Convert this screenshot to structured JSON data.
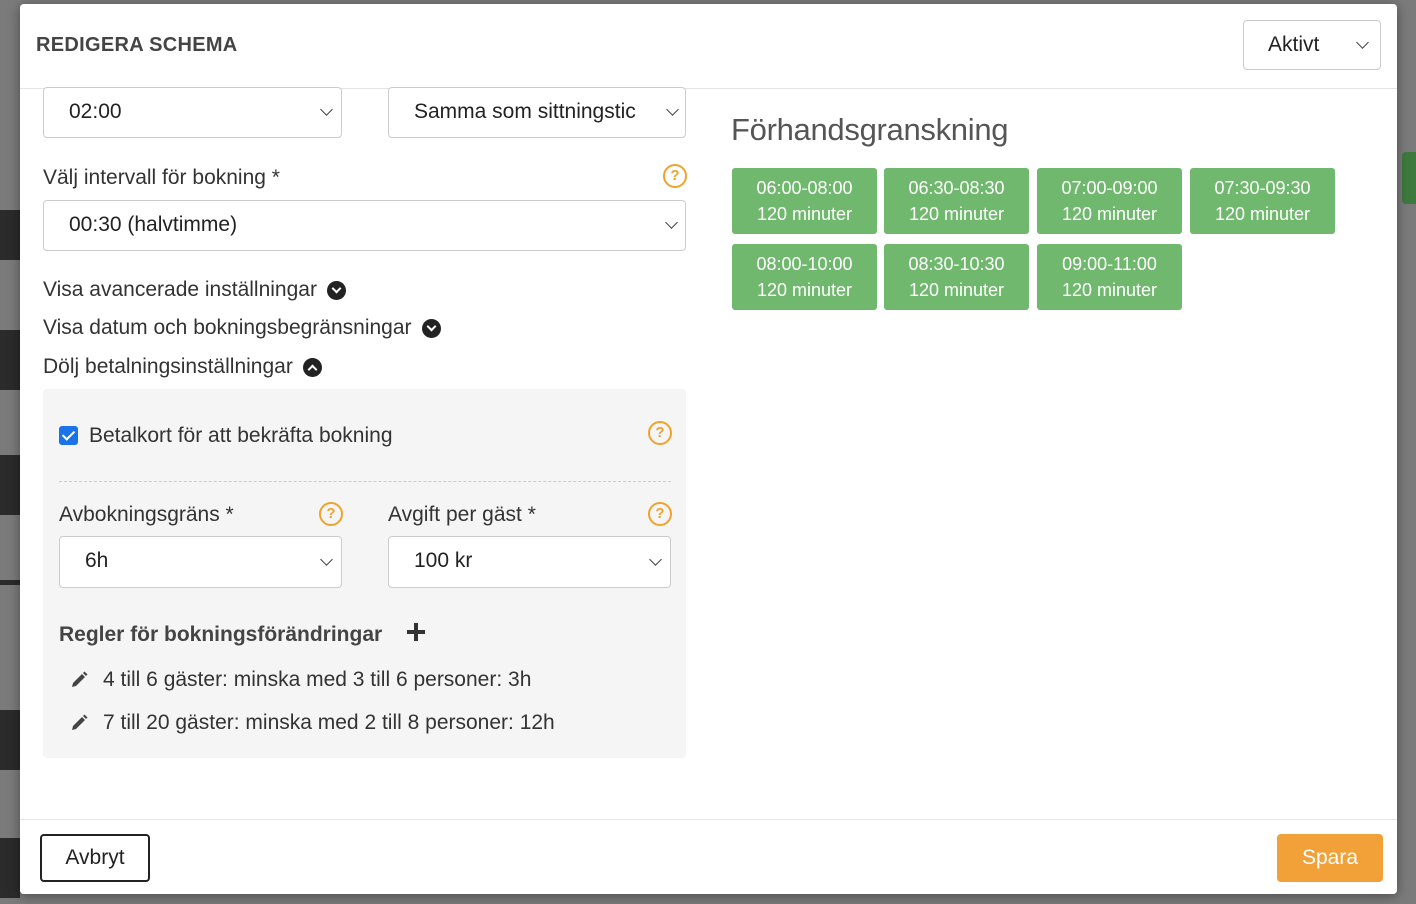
{
  "modal": {
    "title": "REDIGERA SCHEMA",
    "status": {
      "value": "Aktivt"
    }
  },
  "form": {
    "duration_select": {
      "value": "02:00"
    },
    "other_select": {
      "value": "Samma som sittningstic"
    },
    "interval": {
      "label": "Välj intervall för bokning *",
      "value": "00:30 (halvtimme)"
    },
    "toggles": {
      "advanced": "Visa avancerade inställningar",
      "dates": "Visa datum och bokningsbegränsningar",
      "payment": "Dölj betalningsinställningar"
    },
    "payment": {
      "card_label": "Betalkort för att bekräfta bokning",
      "cancel_limit": {
        "label": "Avbokningsgräns *",
        "value": "6h"
      },
      "fee": {
        "label": "Avgift per gäst *",
        "value": "100 kr"
      },
      "rules_title": "Regler för bokningsförändringar",
      "rules": [
        "4 till 6 gäster: minska med 3 till 6 personer: 3h",
        "7 till 20 gäster: minska med 2 till 8 personer: 12h"
      ]
    }
  },
  "preview": {
    "title": "Förhandsgranskning",
    "slots": [
      {
        "time": "06:00-08:00",
        "duration": "120 minuter"
      },
      {
        "time": "06:30-08:30",
        "duration": "120 minuter"
      },
      {
        "time": "07:00-09:00",
        "duration": "120 minuter"
      },
      {
        "time": "07:30-09:30",
        "duration": "120 minuter"
      },
      {
        "time": "08:00-10:00",
        "duration": "120 minuter"
      },
      {
        "time": "08:30-10:30",
        "duration": "120 minuter"
      },
      {
        "time": "09:00-11:00",
        "duration": "120 minuter"
      }
    ]
  },
  "footer": {
    "cancel_label": "Avbryt",
    "save_label": "Spara"
  },
  "colors": {
    "slot_green": "#6fb86d",
    "save_orange": "#f2a138",
    "help_orange": "#f0a22b",
    "checkbox_blue": "#1a73e8"
  }
}
